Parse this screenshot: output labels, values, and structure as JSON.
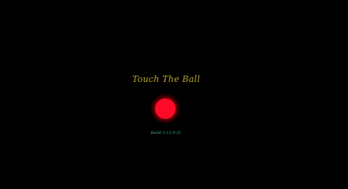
{
  "game": {
    "title": "Touch The Ball",
    "build_label": "Build 5.12.9.21"
  },
  "colors": {
    "background": "#000000",
    "title": "#b5a62a",
    "ball": "#ff0a28",
    "build": "#3bb7a6"
  }
}
